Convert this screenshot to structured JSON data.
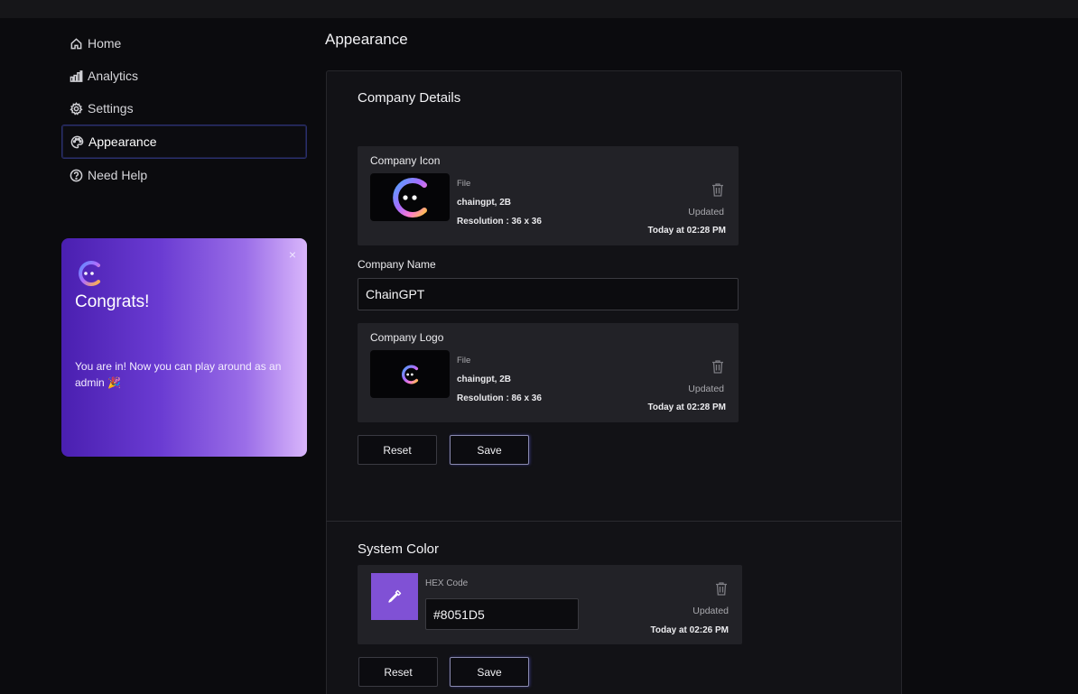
{
  "sidebar": {
    "items": [
      {
        "label": "Home",
        "icon": "home-icon"
      },
      {
        "label": "Analytics",
        "icon": "analytics-icon"
      },
      {
        "label": "Settings",
        "icon": "gear-icon"
      },
      {
        "label": "Appearance",
        "icon": "palette-icon",
        "active": true
      },
      {
        "label": "Need Help",
        "icon": "help-icon"
      }
    ]
  },
  "promo": {
    "title": "Congrats!",
    "message": "You are in! Now you can play around as an admin 🎉",
    "close": "×"
  },
  "page": {
    "title": "Appearance"
  },
  "company": {
    "section_title": "Company Details",
    "icon_card": {
      "label": "Company Icon",
      "file_label": "File",
      "file_name": "chaingpt, 2B",
      "resolution": "Resolution : 36 x 36",
      "updated_label": "Updated",
      "updated_time": "Today at 02:28 PM"
    },
    "name_label": "Company Name",
    "name_value": "ChainGPT",
    "logo_card": {
      "label": "Company Logo",
      "file_label": "File",
      "file_name": "chaingpt, 2B",
      "resolution": "Resolution : 86 x 36",
      "updated_label": "Updated",
      "updated_time": "Today at 02:28 PM"
    },
    "reset_label": "Reset",
    "save_label": "Save"
  },
  "system_color": {
    "section_title": "System Color",
    "hex_label": "HEX Code",
    "hex_value": "#8051D5",
    "updated_label": "Updated",
    "updated_time": "Today at 02:26 PM",
    "reset_label": "Reset",
    "save_label": "Save"
  },
  "colors": {
    "accent": "#8051D5",
    "background": "#0b0b0e",
    "panel": "#121216",
    "card": "#222227"
  }
}
